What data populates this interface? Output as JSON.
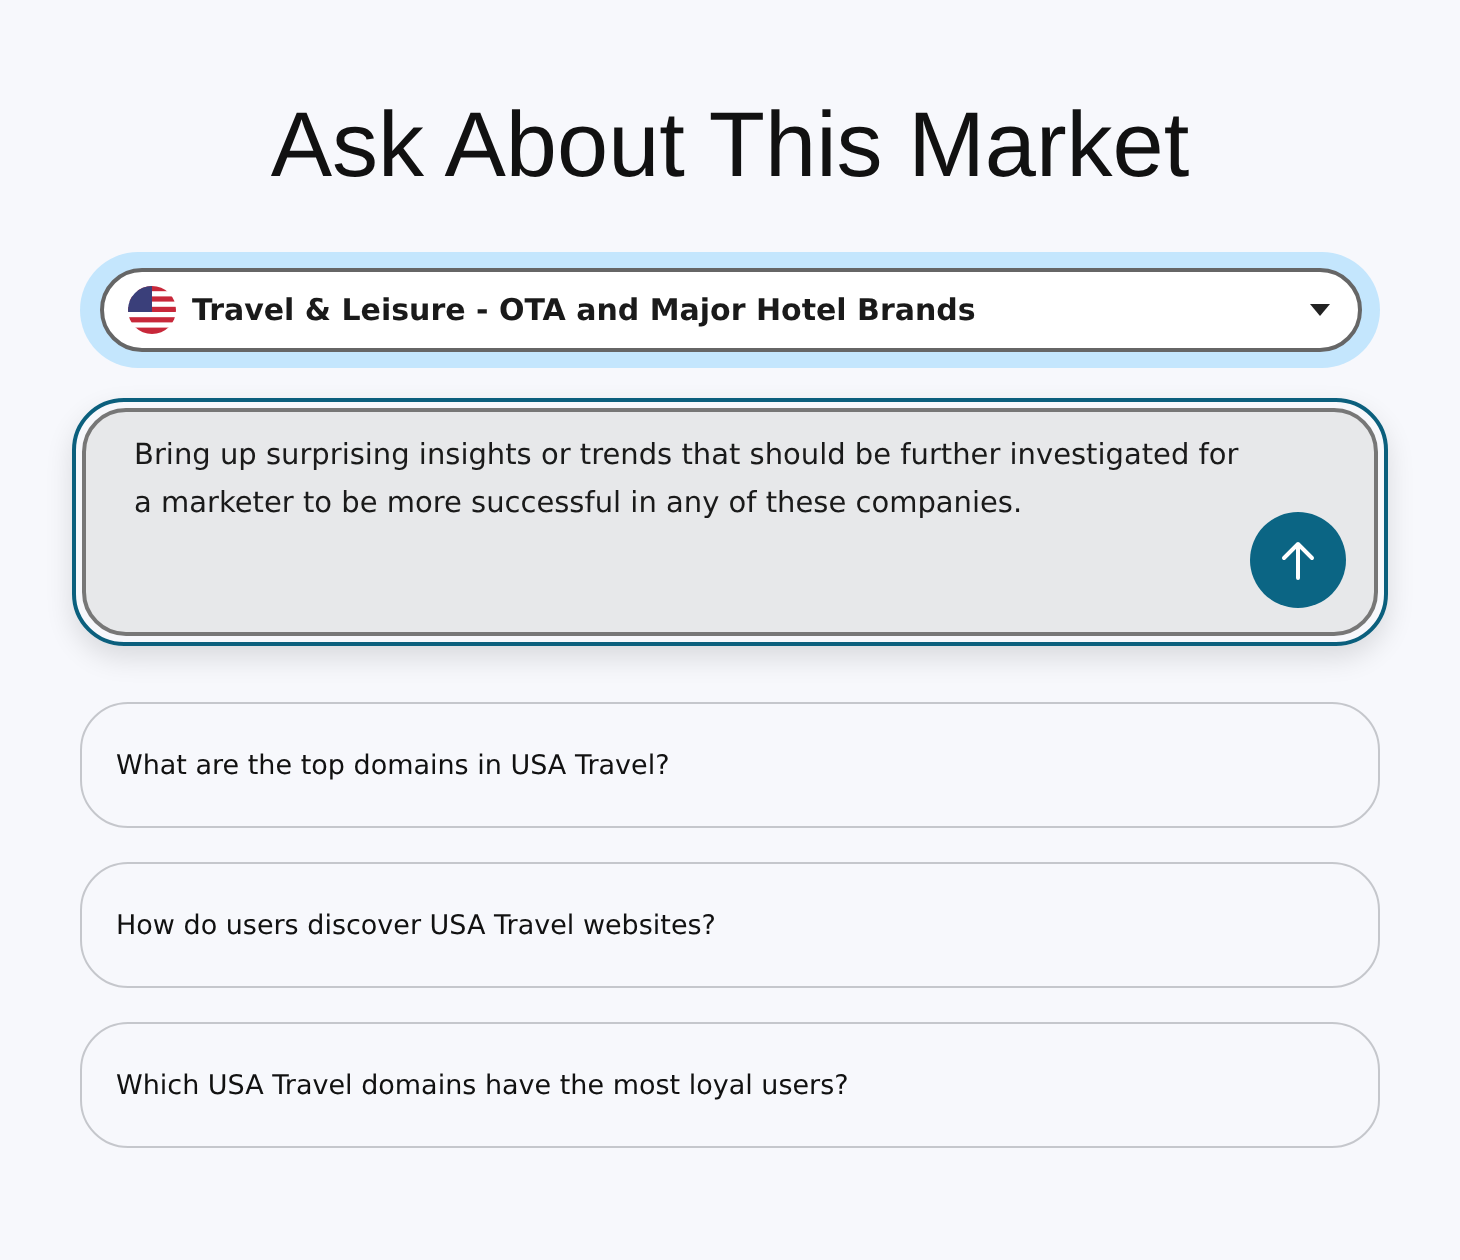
{
  "title": "Ask About This Market",
  "market_select": {
    "value": "Travel & Leisure - OTA and Major Hotel Brands",
    "focused": true
  },
  "prompt": {
    "value": "Bring up surprising insights or trends that should be further investigated for a marketer to be more successful in any of these companies.",
    "focused": true
  },
  "suggestions": [
    {
      "text": "What are the top domains in USA Travel?"
    },
    {
      "text": "How do users discover USA Travel websites?"
    },
    {
      "text": "Which USA Travel domains have the most loyal users?"
    }
  ]
}
